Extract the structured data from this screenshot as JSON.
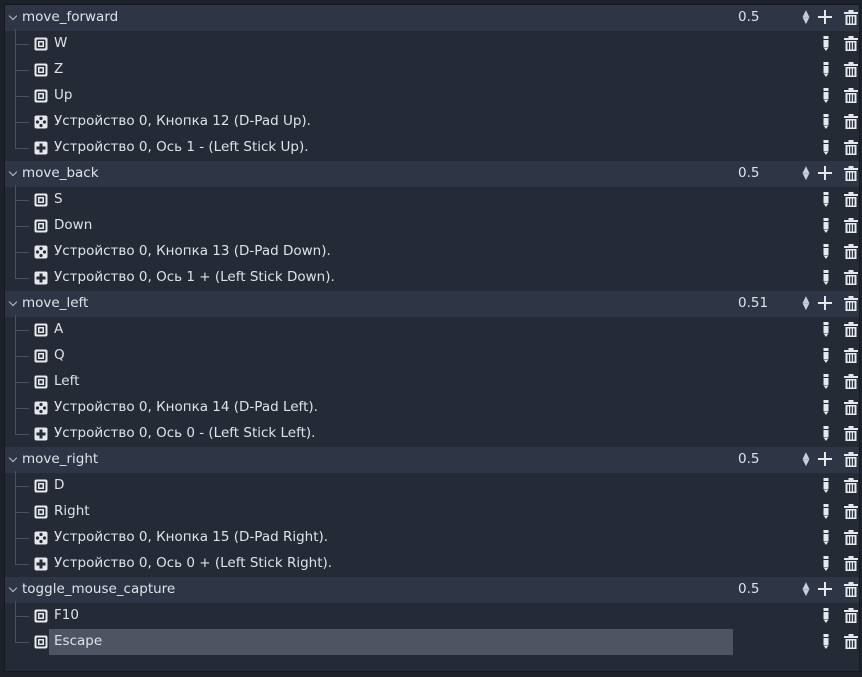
{
  "actions": [
    {
      "name": "move_forward",
      "deadzone": "0.5",
      "events": [
        {
          "type": "key",
          "label": "W"
        },
        {
          "type": "key",
          "label": "Z"
        },
        {
          "type": "key",
          "label": "Up"
        },
        {
          "type": "joy_button",
          "label": "Устройство 0, Кнопка 12 (D-Pad Up)."
        },
        {
          "type": "joy_axis",
          "label": "Устройство 0, Ось 1 - (Left Stick Up)."
        }
      ]
    },
    {
      "name": "move_back",
      "deadzone": "0.5",
      "events": [
        {
          "type": "key",
          "label": "S"
        },
        {
          "type": "key",
          "label": "Down"
        },
        {
          "type": "joy_button",
          "label": "Устройство 0, Кнопка 13 (D-Pad Down)."
        },
        {
          "type": "joy_axis",
          "label": "Устройство 0, Ось 1 + (Left Stick Down)."
        }
      ]
    },
    {
      "name": "move_left",
      "deadzone": "0.51",
      "events": [
        {
          "type": "key",
          "label": "A"
        },
        {
          "type": "key",
          "label": "Q"
        },
        {
          "type": "key",
          "label": "Left"
        },
        {
          "type": "joy_button",
          "label": "Устройство 0, Кнопка 14 (D-Pad Left)."
        },
        {
          "type": "joy_axis",
          "label": "Устройство 0, Ось 0 - (Left Stick Left)."
        }
      ]
    },
    {
      "name": "move_right",
      "deadzone": "0.5",
      "events": [
        {
          "type": "key",
          "label": "D"
        },
        {
          "type": "key",
          "label": "Right"
        },
        {
          "type": "joy_button",
          "label": "Устройство 0, Кнопка 15 (D-Pad Right)."
        },
        {
          "type": "joy_axis",
          "label": "Устройство 0, Ось 0 + (Left Stick Right)."
        }
      ]
    },
    {
      "name": "toggle_mouse_capture",
      "deadzone": "0.5",
      "events": [
        {
          "type": "key",
          "label": "F10"
        },
        {
          "type": "key",
          "label": "Escape",
          "selected": true
        }
      ]
    }
  ],
  "icons": {
    "collapse": "chevron-down-icon",
    "key": "keyboard-icon",
    "joy_button": "gamepad-button-icon",
    "joy_axis": "gamepad-axis-icon",
    "add": "plus-icon",
    "edit": "edit-icon",
    "remove": "trash-icon"
  },
  "colors": {
    "background": "#242a36",
    "action_row": "#2e3545",
    "selected_row": "#4f5463",
    "text": "#dfe2e8"
  }
}
